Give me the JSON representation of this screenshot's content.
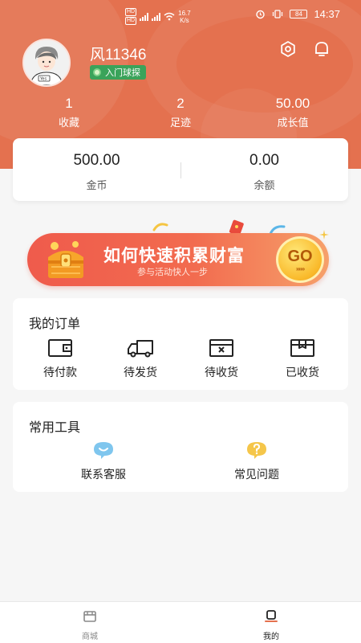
{
  "status_bar": {
    "net_speed_value": "16.7",
    "net_speed_unit": "K/s",
    "battery": "84",
    "time": "14:37"
  },
  "profile": {
    "username": "风11346",
    "badge_label": "入门球探",
    "avatar_text": "Yes"
  },
  "stats": [
    {
      "value": "1",
      "label": "收藏"
    },
    {
      "value": "2",
      "label": "足迹"
    },
    {
      "value": "50.00",
      "label": "成长值"
    }
  ],
  "wallet": [
    {
      "value": "500.00",
      "label": "金币"
    },
    {
      "value": "0.00",
      "label": "余额"
    }
  ],
  "banner": {
    "title": "如何快速积累财富",
    "subtitle": "参与活动快人一步",
    "go_label": "GO",
    "go_arrows": "»»»"
  },
  "orders": {
    "title": "我的订单",
    "items": [
      {
        "label": "待付款",
        "icon": "wallet-icon"
      },
      {
        "label": "待发货",
        "icon": "truck-icon"
      },
      {
        "label": "待收货",
        "icon": "box-x-icon"
      },
      {
        "label": "已收货",
        "icon": "package-icon"
      }
    ]
  },
  "tools": {
    "title": "常用工具",
    "items": [
      {
        "label": "联系客服",
        "icon": "chat-smile-icon",
        "color": "#7fc6ee"
      },
      {
        "label": "常见问题",
        "icon": "question-bubble-icon",
        "color": "#f5c64a"
      }
    ]
  },
  "bottom_nav": {
    "items": [
      {
        "label": "商城",
        "icon": "store-icon",
        "active": false
      },
      {
        "label": "我的",
        "icon": "profile-icon",
        "active": true
      }
    ]
  },
  "colors": {
    "brand": "#e4714f",
    "badge_green": "#3aa35a",
    "nav_active": "#222222",
    "nav_inactive": "#888888"
  }
}
